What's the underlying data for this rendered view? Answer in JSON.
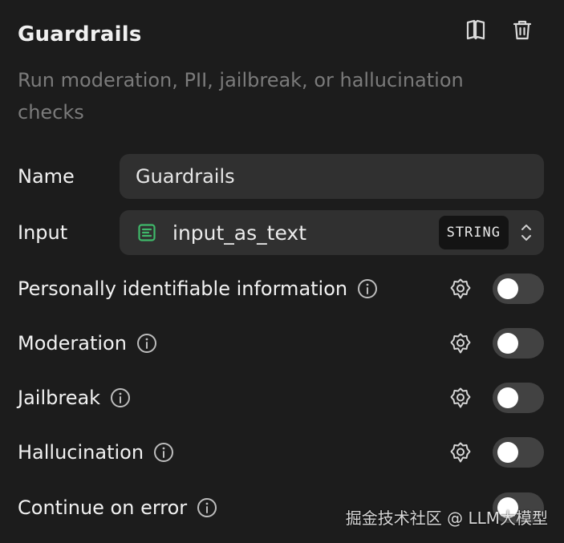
{
  "header": {
    "title": "Guardrails",
    "description": "Run moderation, PII, jailbreak, or hallucination checks",
    "actions": [
      {
        "name": "book-icon"
      },
      {
        "name": "trash-icon"
      }
    ]
  },
  "fields": {
    "name": {
      "label": "Name",
      "value": "Guardrails"
    },
    "input": {
      "label": "Input",
      "value": "input_as_text",
      "type_badge": "STRING",
      "icon": "variable-icon"
    }
  },
  "checks": [
    {
      "label": "Personally identifiable information",
      "enabled": false
    },
    {
      "label": "Moderation",
      "enabled": false
    },
    {
      "label": "Jailbreak",
      "enabled": false
    },
    {
      "label": "Hallucination",
      "enabled": false
    }
  ],
  "continue_on_error": {
    "label": "Continue on error",
    "enabled": false
  },
  "watermark": "掘金技术社区 @ LLM大模型",
  "colors": {
    "background": "#1c1c1c",
    "field_bg": "#303030",
    "toggle_off": "#424242",
    "variable_icon": "#3fb96a",
    "muted_text": "#7b7b7b"
  }
}
